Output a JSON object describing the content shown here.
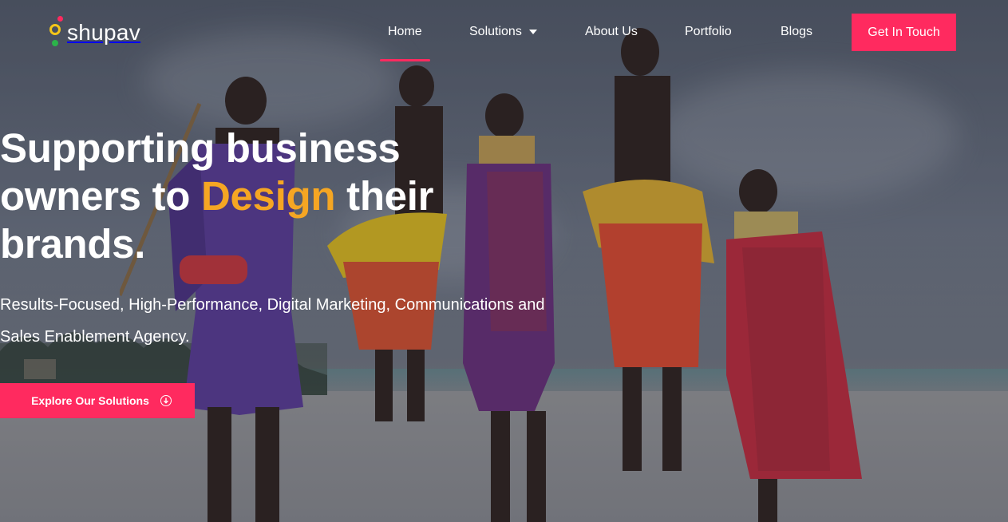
{
  "brand": {
    "name": "shupav",
    "colors": {
      "accent": "#ff2a5f",
      "highlight": "#f5a623",
      "logo_yellow": "#f5c518",
      "logo_red": "#ff2a5f",
      "logo_green": "#2bb34a"
    }
  },
  "nav": {
    "items": [
      {
        "label": "Home",
        "active": true
      },
      {
        "label": "Solutions",
        "has_dropdown": true
      },
      {
        "label": "About Us"
      },
      {
        "label": "Portfolio"
      },
      {
        "label": "Blogs"
      }
    ],
    "cta_label": "Get In Touch"
  },
  "hero": {
    "title_part1": "Supporting business owners to ",
    "title_highlight": "Design",
    "title_part2": " their brands.",
    "subtitle": "Results-Focused, High-Performance, Digital Marketing, Communications and Sales Enablement Agency.",
    "cta_label": "Explore Our Solutions",
    "cta_icon": "arrow-down-circle-icon"
  }
}
